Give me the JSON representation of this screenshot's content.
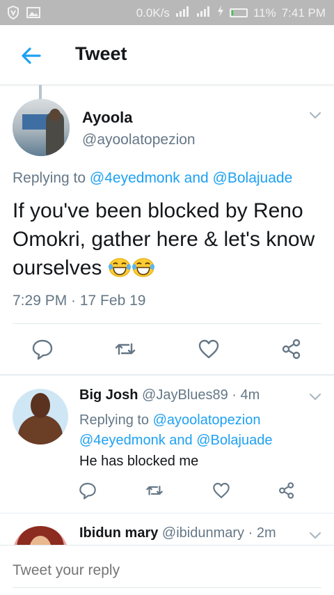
{
  "status_bar": {
    "net_speed": "0.0K/s",
    "battery_pct": "11%",
    "time": "7:41 PM",
    "battery_level": 0.11
  },
  "header": {
    "title": "Tweet"
  },
  "main_tweet": {
    "name": "Ayoola",
    "handle": "@ayoolatopezion",
    "replying_prefix": "Replying to",
    "reply_to_1": "@4eyedmonk",
    "reply_and": "and",
    "reply_to_2": "@Bolajuade",
    "text": "If you've been blocked by Reno Omokri, gather here & let's know ourselves",
    "emoji": "face-with-tears-of-joy",
    "timestamp": "7:29 PM · 17 Feb 19"
  },
  "replies": [
    {
      "name": "Big Josh",
      "handle": "@JayBlues89",
      "age": "· 4m",
      "replying_prefix": "Replying to",
      "reply_to_1": "@ayoolatopezion",
      "reply_to_2": "@4eyedmonk",
      "reply_and": "and",
      "reply_to_3": "@Bolajuade",
      "text": "He has blocked me"
    },
    {
      "name": "Ibidun mary",
      "handle": "@ibidunmary",
      "age": "· 2m"
    }
  ],
  "reply_bar": {
    "placeholder": "Tweet your reply"
  },
  "colors": {
    "accent": "#1da1f2",
    "secondary_text": "#657786",
    "icon": "#657786"
  }
}
